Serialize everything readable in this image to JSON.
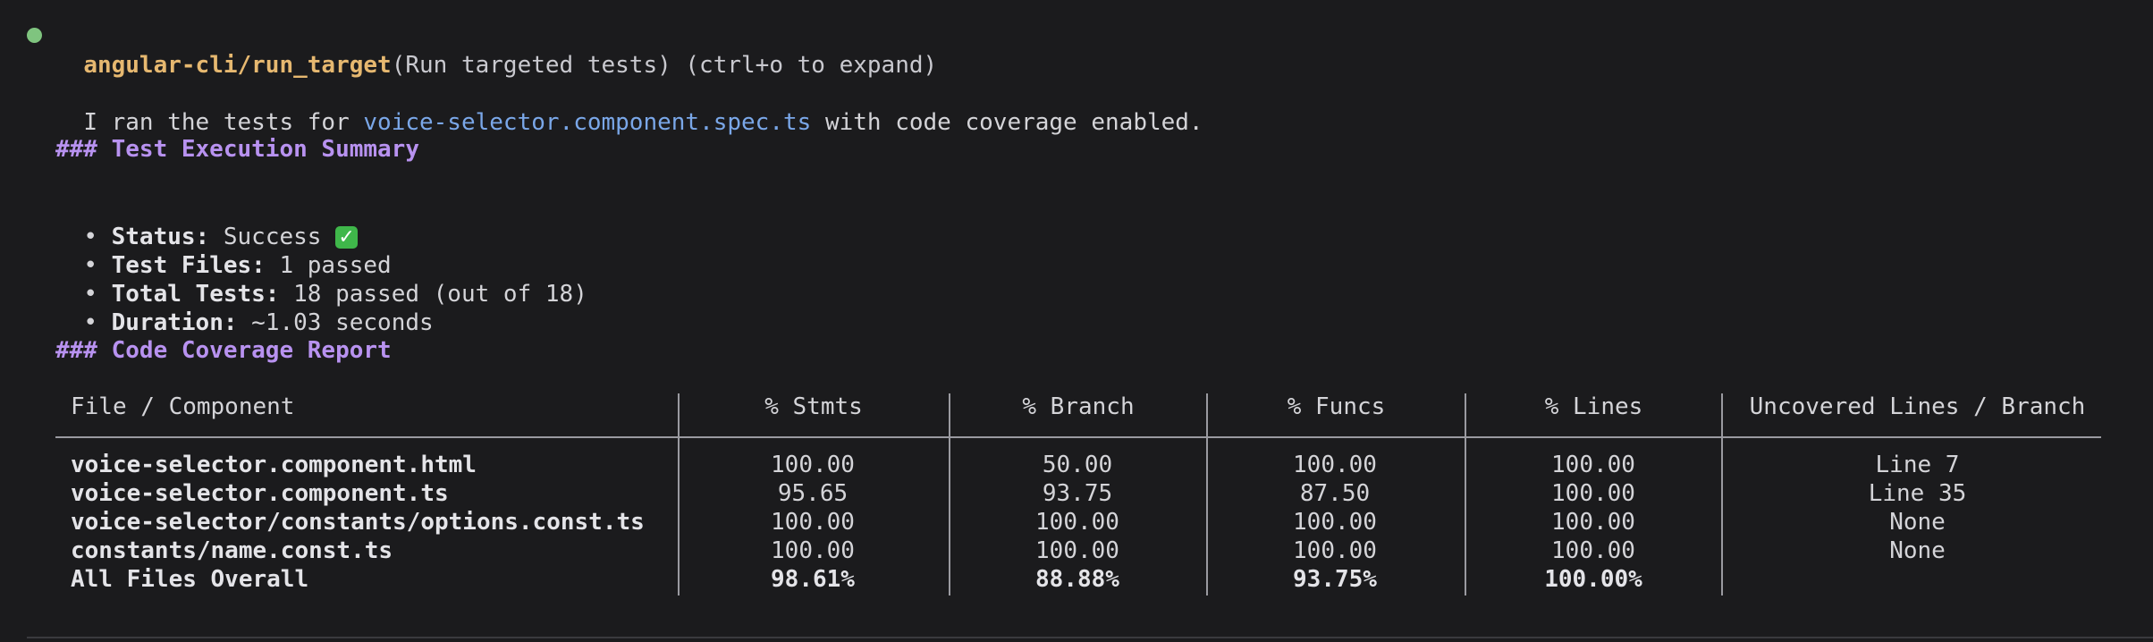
{
  "header": {
    "tool_name": "angular-cli/run_target",
    "tool_desc": "(Run targeted tests) (ctrl+o to expand)"
  },
  "intro": {
    "before": "I ran the tests for ",
    "file": "voice-selector.component.spec.ts",
    "after": " with code coverage enabled."
  },
  "summary": {
    "heading": "### Test Execution Summary",
    "items": [
      {
        "label": "Status:",
        "value": " Success "
      },
      {
        "label": "Test Files:",
        "value": " 1 passed"
      },
      {
        "label": "Total Tests:",
        "value": " 18 passed (out of 18)"
      },
      {
        "label": "Duration:",
        "value": " ~1.03 seconds"
      }
    ],
    "bullet": "•",
    "success_icon": "check-mark-button-icon",
    "success_icon_glyph": "✓"
  },
  "coverage": {
    "heading": "### Code Coverage Report",
    "columns": [
      "File / Component",
      "% Stmts",
      "% Branch",
      "% Funcs",
      "% Lines",
      "Uncovered Lines / Branch"
    ],
    "rows": [
      [
        "voice-selector.component.html",
        "100.00",
        "50.00",
        "100.00",
        "100.00",
        "Line 7"
      ],
      [
        "voice-selector.component.ts",
        "95.65",
        "93.75",
        "87.50",
        "100.00",
        "Line 35"
      ],
      [
        "voice-selector/constants/options.const.ts",
        "100.00",
        "100.00",
        "100.00",
        "100.00",
        "None"
      ],
      [
        "constants/name.const.ts",
        "100.00",
        "100.00",
        "100.00",
        "100.00",
        "None"
      ],
      [
        "All Files Overall",
        "98.61%",
        "88.88%",
        "93.75%",
        "100.00%",
        ""
      ]
    ]
  },
  "colors": {
    "background": "#1b1b1d",
    "tool": "#e6b870",
    "heading": "#b892f0",
    "link": "#7aa7e8",
    "status_dot": "#7fc47f",
    "check": "#3fb74a"
  }
}
